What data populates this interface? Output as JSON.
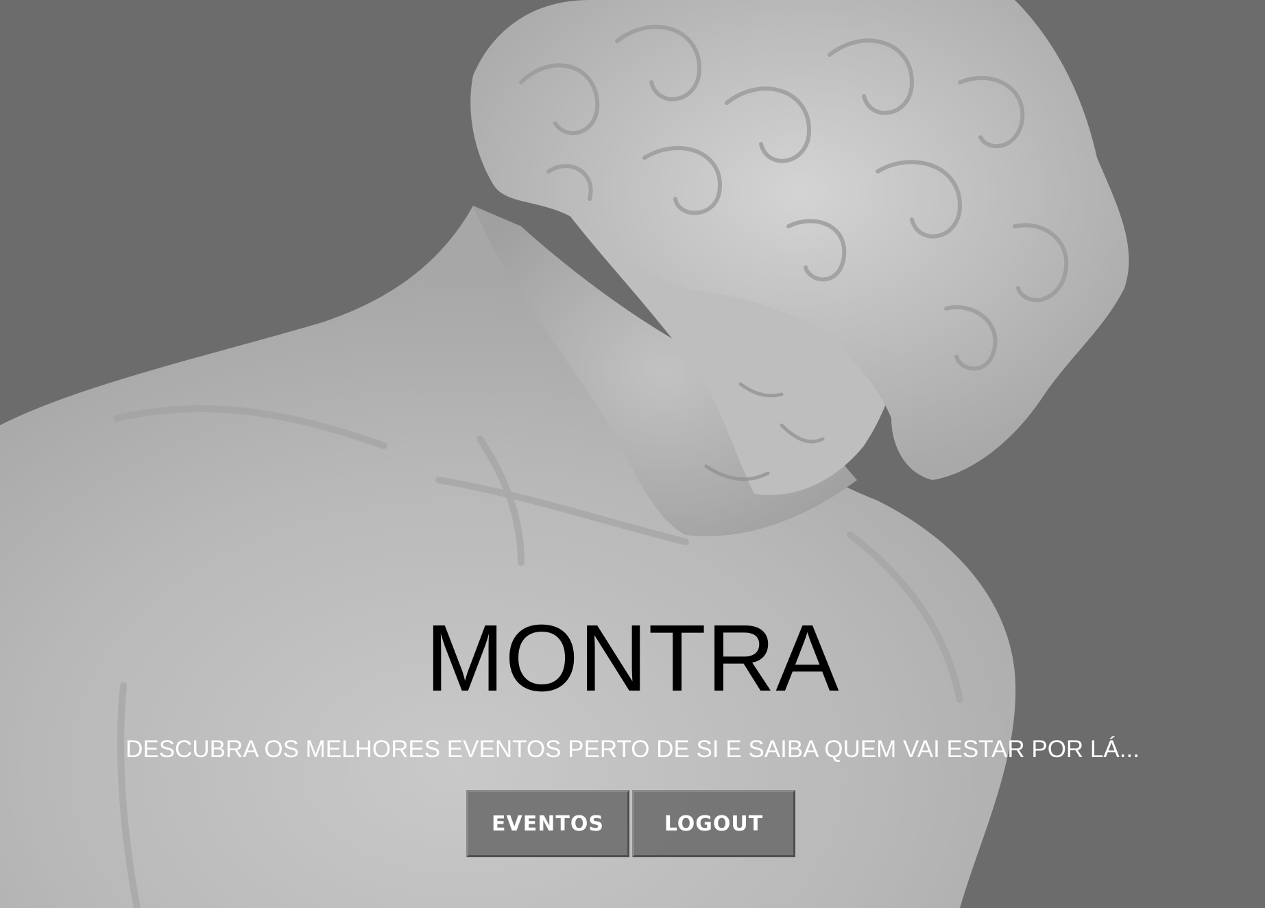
{
  "hero": {
    "title": "MONTRA",
    "tagline": "DESCUBRA OS MELHORES EVENTOS PERTO DE SI E SAIBA QUEM VAI ESTAR POR LÁ..."
  },
  "buttons": {
    "events_label": "EVENTOS",
    "logout_label": "LOGOUT"
  },
  "colors": {
    "background": "#6c6c6c",
    "marble": "#bdbdbd",
    "title_text": "#000000",
    "tagline_text": "#ffffff",
    "button_bg": "#6c6c6c"
  },
  "background_image": "marble-statue-photo"
}
